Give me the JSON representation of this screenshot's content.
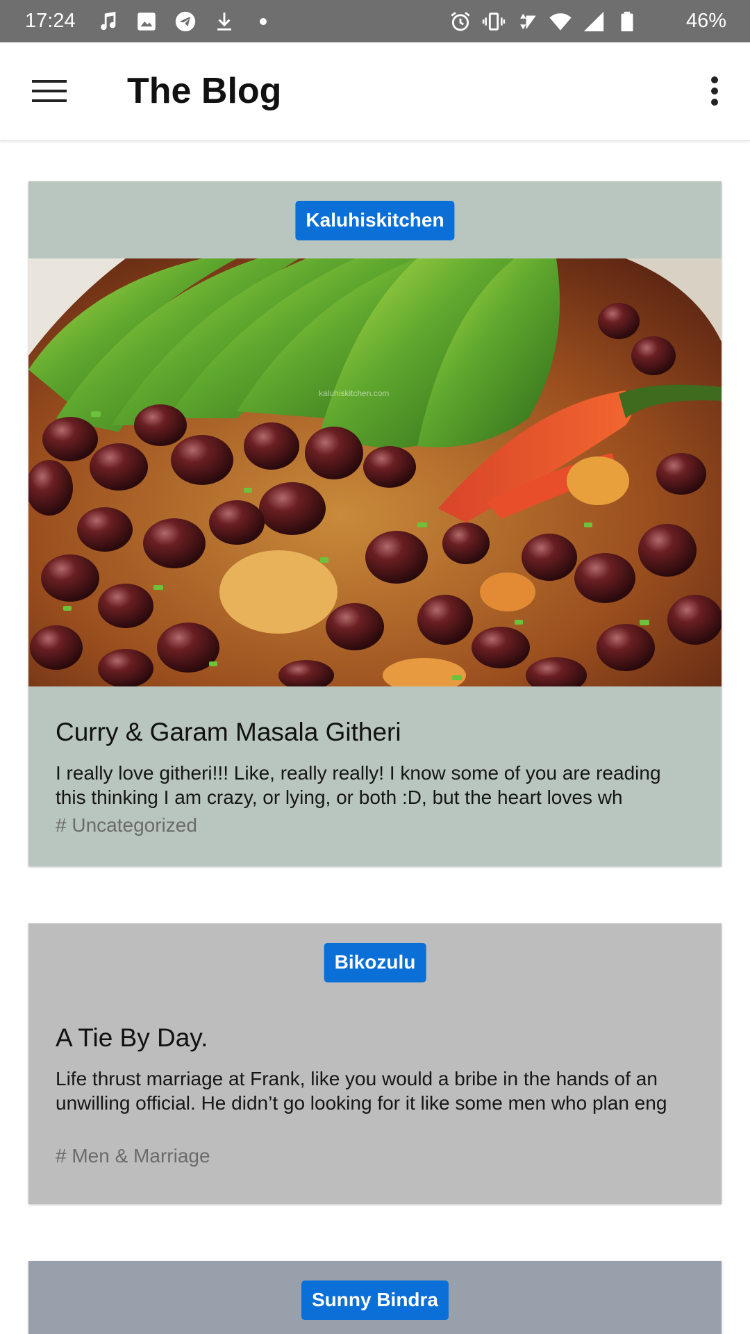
{
  "status_bar": {
    "time": "17:24",
    "battery_percent": "46%",
    "left_icons": [
      "music-note-icon",
      "image-icon",
      "telegram-icon",
      "download-icon",
      "dot-icon"
    ],
    "right_icons": [
      "alarm-icon",
      "vibrate-icon",
      "wifi-icon",
      "signal-icon",
      "signal-icon",
      "battery-icon"
    ]
  },
  "app_bar": {
    "title": "The Blog",
    "menu_icon": "hamburger-menu-icon",
    "overflow_icon": "more-vertical-icon"
  },
  "posts": [
    {
      "source": "Kaluhiskitchen",
      "image_watermark": "kaluhiskitchen.com",
      "title": "Curry & Garam Masala Githeri",
      "excerpt": "I really love githeri!!! Like, really really! I know some of you are reading this thinking I am crazy, or lying, or both :D, but the heart loves wh",
      "tag": "# Uncategorized"
    },
    {
      "source": "Bikozulu",
      "title": "A Tie By Day.",
      "excerpt": "Life thrust marriage at Frank, like you would a bribe in the hands of an unwilling official. He didn’t go looking for it like some men who plan eng",
      "tag": "# Men & Marriage"
    },
    {
      "source": "Sunny Bindra"
    }
  ],
  "colors": {
    "status_bar": "#6f6f6f",
    "badge": "#0a6fd6",
    "card_1_bg": "#b8c6bf",
    "card_2_bg": "#bdbdbd",
    "card_3_bg": "#98a1ab",
    "tag_text": "#6b6b6b"
  }
}
